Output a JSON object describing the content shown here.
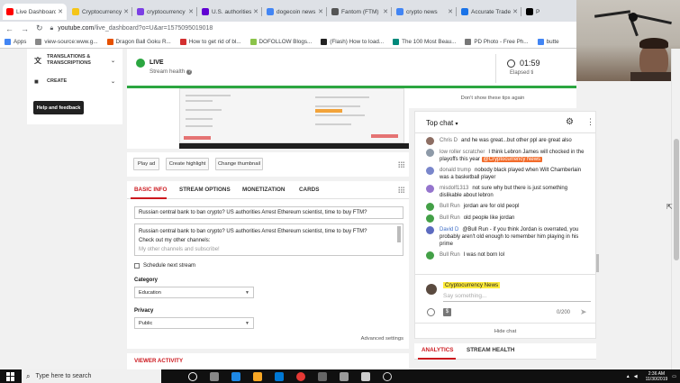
{
  "browser": {
    "tabs": [
      {
        "title": "Live Dashboard",
        "color": "#ff0000"
      },
      {
        "title": "Cryptocurrency",
        "color": "#f5c518"
      },
      {
        "title": "cryptocurrency",
        "color": "#7b3fe4"
      },
      {
        "title": "U.S. authorities",
        "color": "#6001d2"
      },
      {
        "title": "dogecoin news",
        "color": "#4285f4"
      },
      {
        "title": "Fantom (FTM)",
        "color": "#555555"
      },
      {
        "title": "crypto news",
        "color": "#4285f4"
      },
      {
        "title": "Accurate Trade",
        "color": "#1a73e8"
      },
      {
        "title": "P",
        "color": "#000000"
      }
    ],
    "url_host": "youtube.com",
    "url_path": "/live_dashboard?o=U&ar=1575095019018",
    "bookmarks": [
      {
        "label": "Apps",
        "color": "#4285f4"
      },
      {
        "label": "view-source:www.g...",
        "color": "#888888"
      },
      {
        "label": "Dragon Ball Goku R...",
        "color": "#e65100"
      },
      {
        "label": "How to get rid of bl...",
        "color": "#d32f2f"
      },
      {
        "label": "DOFOLLOW Blogs...",
        "color": "#8bc34a"
      },
      {
        "label": "(Flash) How to load...",
        "color": "#222222"
      },
      {
        "label": "The 100 Most Beau...",
        "color": "#00897b"
      },
      {
        "label": "PD Photo - Free Ph...",
        "color": "#777777"
      },
      {
        "label": "butte",
        "color": "#4285f4"
      }
    ]
  },
  "sidebar": {
    "items": [
      {
        "label": "TRANSLATIONS & TRANSCRIPTIONS",
        "icon": "translate-icon"
      },
      {
        "label": "CREATE",
        "icon": "camera-icon"
      }
    ],
    "help_button": "Help and feedback"
  },
  "header": {
    "status": "LIVE",
    "health_label": "Stream health",
    "timer": "01:59",
    "elapsed_label": "Elapsed ti"
  },
  "tips": {
    "dont_show": "Don't show these tips again"
  },
  "actions": {
    "play_ad": "Play ad",
    "create_highlight": "Create highlight",
    "change_thumbnail": "Change thumbnail"
  },
  "info": {
    "tabs": [
      "BASIC INFO",
      "STREAM OPTIONS",
      "MONETIZATION",
      "CARDS"
    ],
    "title_value": "Russian central bank to ban crypto? US authorities Arrest Ethereum scientist, time to buy FTM?",
    "description_line1": "Russian central bank to ban crypto? US authorities Arrest Ethereum scientist, time to buy FTM?",
    "description_line2": "Check out my other channels:",
    "description_line3": "My other channels and subscribe!",
    "schedule_label": "Schedule next stream",
    "category_label": "Category",
    "category_value": "Education",
    "privacy_label": "Privacy",
    "privacy_value": "Public",
    "advanced": "Advanced settings"
  },
  "viewer_activity": "VIEWER ACTIVITY",
  "chat": {
    "title": "Top chat",
    "messages": [
      {
        "author": "Chris D",
        "text": "and he was great...but other ppl are great also",
        "color": "#8d6e63"
      },
      {
        "author": "low roller scratcher",
        "text": "I think Lebron James will chocked in the playoffs this year",
        "mention": "@Cryptocurrency News",
        "color": "#8e9aa8"
      },
      {
        "author": "donald trump",
        "text": "nobody black played when Wilt Chamberlain was a basketball player",
        "color": "#7986cb"
      },
      {
        "author": "misdolf1313",
        "text": "not sure why but there is just something dislikable about lebron",
        "color": "#9575cd"
      },
      {
        "author": "Bull Run",
        "text": "jordan are for old peopl",
        "color": "#43a047"
      },
      {
        "author": "Bull Run",
        "text": "old people like jordan",
        "color": "#43a047"
      },
      {
        "author": "David D",
        "text": "@Bull Run - if you think Jordan is overrated, you probably aren't old enough to remember him playing in his prime",
        "color": "#5c6bc0"
      },
      {
        "author": "Bull Run",
        "text": "I was not born lol",
        "color": "#43a047"
      }
    ],
    "compose_name": "Cryptocurrency News",
    "placeholder": "Say something...",
    "counter": "0/200",
    "hide": "Hide chat"
  },
  "analytics_tabs": [
    "ANALYTICS",
    "STREAM HEALTH"
  ],
  "taskbar": {
    "search_placeholder": "Type here to search",
    "time": "2:36 AM",
    "date": "11/30/2019"
  }
}
